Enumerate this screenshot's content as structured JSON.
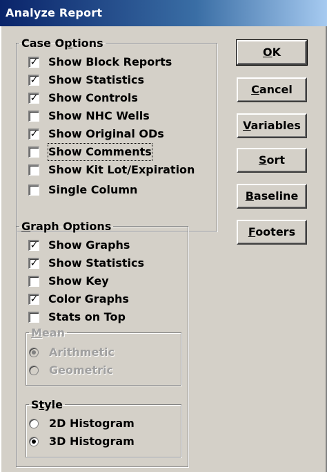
{
  "window": {
    "title": "Analyze Report"
  },
  "case_options": {
    "legend": "Case Options",
    "items": [
      {
        "label": "Show Block Reports",
        "checked": true
      },
      {
        "label": "Show Statistics",
        "checked": true
      },
      {
        "label": "Show Controls",
        "checked": true
      },
      {
        "label": "Show NHC Wells",
        "checked": false
      },
      {
        "label": "Show Original ODs",
        "checked": true
      },
      {
        "label": "Show Comments",
        "checked": false
      },
      {
        "label": "Show Kit Lot/Expiration",
        "checked": false
      },
      {
        "label": "Single Column",
        "checked": false
      }
    ]
  },
  "graph_options": {
    "legend": "Graph Options",
    "items": [
      {
        "label": "Show Graphs",
        "checked": true
      },
      {
        "label": "Show Statistics",
        "checked": true
      },
      {
        "label": "Show Key",
        "checked": false
      },
      {
        "label": "Color Graphs",
        "checked": true
      },
      {
        "label": "Stats on Top",
        "checked": false
      }
    ],
    "mean": {
      "legend": "Mean",
      "enabled": false,
      "options": [
        {
          "label": "Arithmetic",
          "selected": true
        },
        {
          "label": "Geometric",
          "selected": false
        }
      ]
    },
    "style": {
      "legend": "Style",
      "options": [
        {
          "label": "2D Histogram",
          "selected": false
        },
        {
          "label": "3D Histogram",
          "selected": true
        }
      ]
    }
  },
  "buttons": {
    "ok": "OK",
    "cancel": "Cancel",
    "variables": "Variables",
    "sort": "Sort",
    "baseline": "Baseline",
    "footers": "Footers"
  },
  "mnemonics": {
    "case_options": "p",
    "graph_options": "G",
    "mean": "M",
    "style": "t",
    "ok": "O",
    "cancel": "C",
    "variables": "V",
    "sort": "S",
    "baseline": "B",
    "footers": "F"
  }
}
